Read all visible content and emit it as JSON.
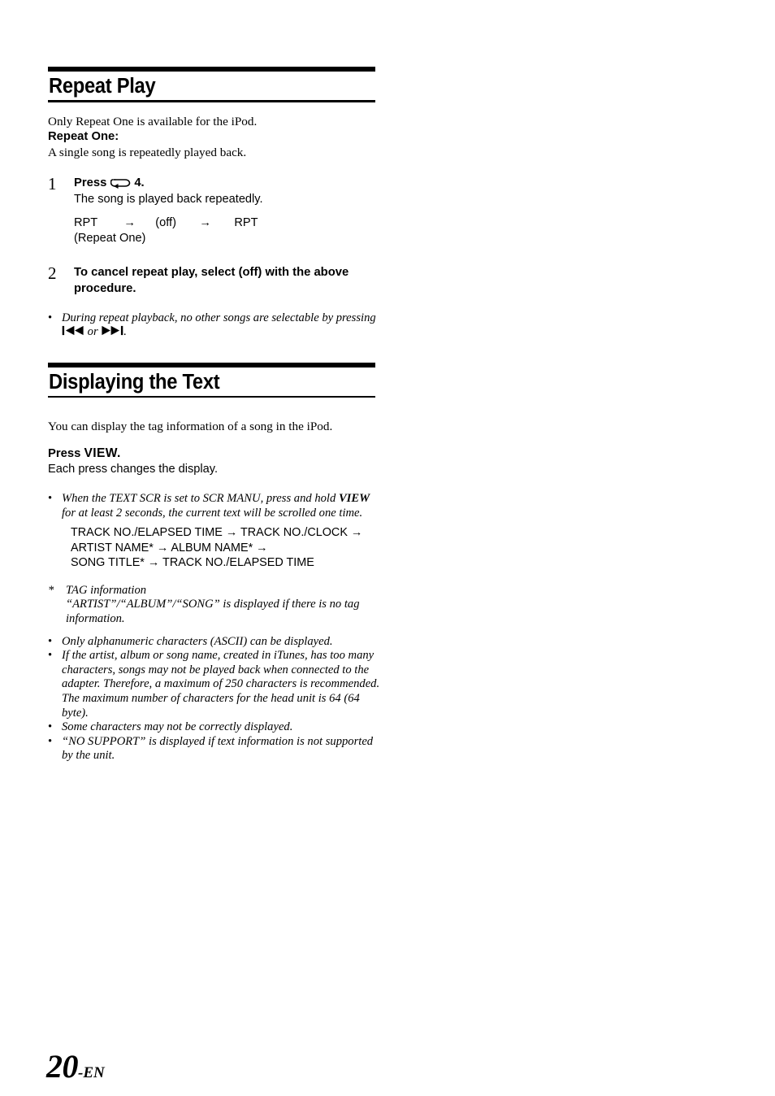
{
  "document": {
    "page_label_number": "20",
    "page_label_suffix": "-EN"
  },
  "sections": [
    {
      "id": "repeat-play",
      "title": "Repeat Play",
      "intro": "Only Repeat One is available for the iPod.",
      "subhead": "Repeat One:",
      "subhead_desc": "A single song is repeatedly played back.",
      "steps": [
        {
          "number": "1",
          "head_before": "Press",
          "head_icon": "repeat-one-icon",
          "head_after": "4.",
          "sub": "The song is played back repeatedly.",
          "flow_line_1": "RPT        →      (off)       →       RPT",
          "flow_line_2": "(Repeat One)"
        },
        {
          "number": "2",
          "head_full": "To cancel repeat play, select (off) with the above procedure."
        }
      ],
      "notes": [
        {
          "mark": "•",
          "text_before": "During repeat playback, no other songs are selectable by pressing",
          "icon_prev": "previous-track-icon",
          "between": "or",
          "icon_next": "next-track-icon",
          "text_after": "."
        }
      ]
    },
    {
      "id": "displaying-the-text",
      "title": "Displaying the Text",
      "intro": "You can display the tag information of a song in the iPod.",
      "press_label_before": "Press",
      "press_label_key": "VIEW.",
      "press_desc": "Each press changes the display.",
      "notes": [
        {
          "mark": "•",
          "segments": [
            {
              "text": "When the TEXT SCR is set to SCR MANU, press and hold ",
              "bold": false
            },
            {
              "text": "VIEW",
              "bold": true
            },
            {
              "text": " for at least 2 seconds, the current text will be scrolled one time.",
              "bold": false
            }
          ]
        }
      ],
      "sequence_lines": [
        "TRACK NO./ELAPSED TIME → TRACK NO./CLOCK →",
        "ARTIST NAME* → ALBUM NAME* →",
        "SONG TITLE* → TRACK NO./ELAPSED TIME"
      ],
      "footnote": {
        "mark": "*",
        "line_1": "TAG information",
        "line_2": "“ARTIST”/“ALBUM”/“SONG” is displayed if there is no tag information."
      },
      "bullets": [
        {
          "mark": "•",
          "text": "Only alphanumeric characters (ASCII) can be displayed."
        },
        {
          "mark": "•",
          "text": "If the artist, album or song name, created in iTunes, has too many characters, songs may not be played back when connected to the adapter. Therefore, a maximum of 250 characters is recommended. The maximum number of characters for the head unit is 64 (64 byte)."
        },
        {
          "mark": "•",
          "text": "Some characters may not be correctly displayed."
        },
        {
          "mark": "•",
          "text": "“NO SUPPORT” is displayed if text information is not supported by the unit."
        }
      ]
    }
  ]
}
